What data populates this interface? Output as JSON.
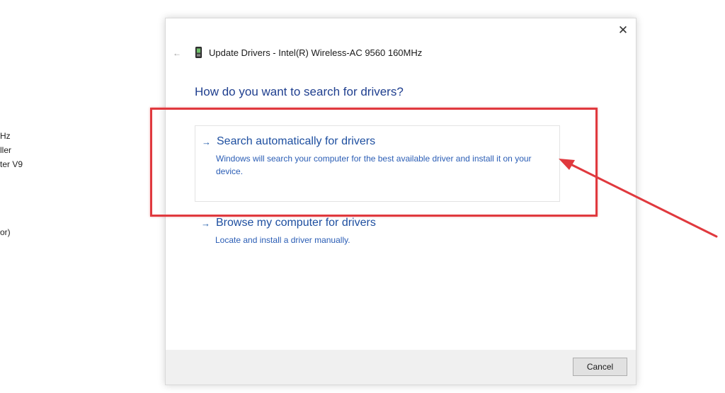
{
  "background": {
    "lines": [
      "Hz",
      "ller",
      "ter V9",
      "or)"
    ]
  },
  "dialog": {
    "title": "Update Drivers - Intel(R) Wireless-AC 9560 160MHz",
    "heading": "How do you want to search for drivers?",
    "close_icon": "close-icon",
    "back_icon": "back-arrow-icon",
    "device_icon": "network-adapter-icon",
    "options": [
      {
        "title": "Search automatically for drivers",
        "description": "Windows will search your computer for the best available driver and install it on your device.",
        "icon": "arrow-right-icon"
      },
      {
        "title": "Browse my computer for drivers",
        "description": "Locate and install a driver manually.",
        "icon": "arrow-right-icon"
      }
    ],
    "cancel_label": "Cancel"
  },
  "colors": {
    "accent_heading": "#1f3f8f",
    "link_blue": "#1e4fa0",
    "annotation_red": "#e0393e",
    "footer_bg": "#f0f0f0"
  }
}
